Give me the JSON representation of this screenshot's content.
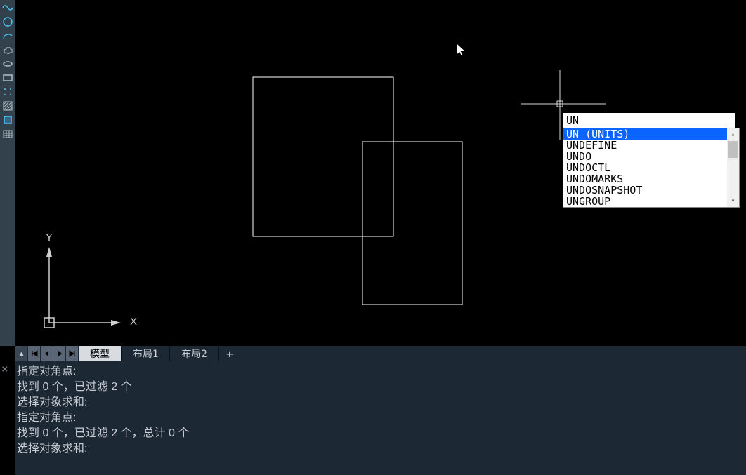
{
  "sidebar": {
    "icons": [
      {
        "name": "spline-icon"
      },
      {
        "name": "circle-icon"
      },
      {
        "name": "arc-icon"
      },
      {
        "name": "revision-cloud-icon"
      },
      {
        "name": "ellipse-icon"
      },
      {
        "name": "rectangle-icon"
      },
      {
        "name": "points-icon"
      },
      {
        "name": "hatch-icon"
      },
      {
        "name": "boundary-icon"
      },
      {
        "name": "table-icon"
      }
    ]
  },
  "ucs": {
    "x_label": "X",
    "y_label": "Y"
  },
  "command_input": {
    "value": "UN"
  },
  "autocomplete": {
    "items": [
      {
        "text": "UN (UNITS)",
        "selected": true
      },
      {
        "text": "UNDEFINE",
        "selected": false
      },
      {
        "text": "UNDO",
        "selected": false
      },
      {
        "text": "UNDOCTL",
        "selected": false
      },
      {
        "text": "UNDOMARKS",
        "selected": false
      },
      {
        "text": "UNDOSNAPSHOT",
        "selected": false
      },
      {
        "text": "UNGROUP",
        "selected": false
      }
    ]
  },
  "tabs": {
    "items": [
      {
        "label": "模型",
        "active": true
      },
      {
        "label": "布局1",
        "active": false
      },
      {
        "label": "布局2",
        "active": false
      }
    ],
    "plus": "+"
  },
  "commandline": {
    "lines": [
      "指定对角点:",
      "找到 0 个，已过滤 2 个",
      "选择对象求和:",
      "指定对角点:",
      "找到 0 个，已过滤 2 个，总计 0 个",
      "选择对象求和:"
    ]
  }
}
